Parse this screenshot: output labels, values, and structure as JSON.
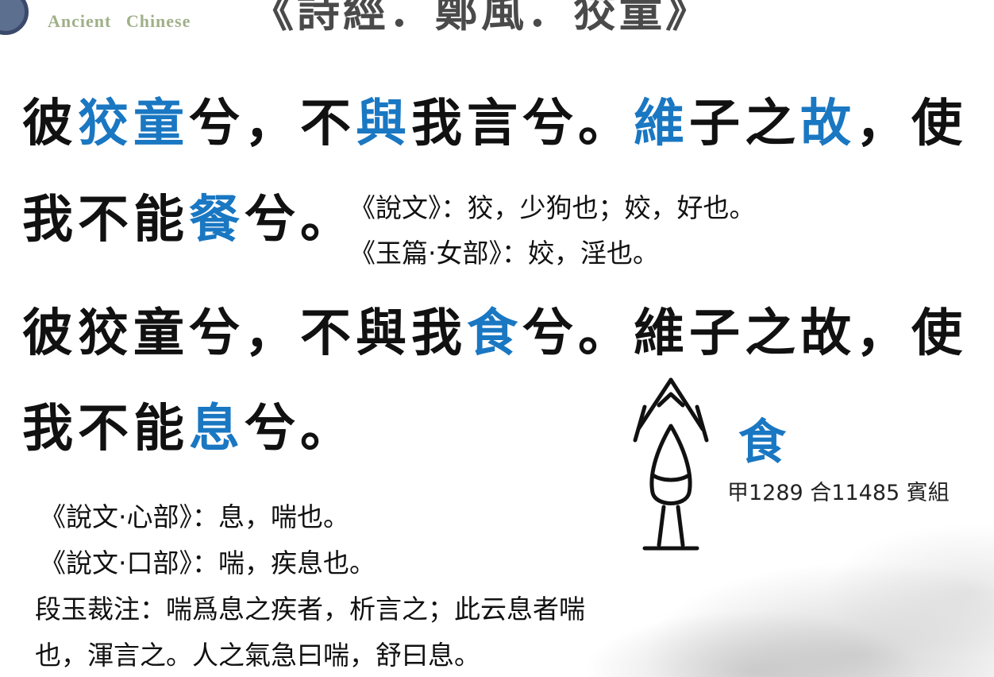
{
  "header": {
    "logo_text": "Ancient Chinese",
    "title": "《詩經．鄭風．狡童》"
  },
  "verses": [
    {
      "segments": [
        {
          "text": "彼",
          "hl": false
        },
        {
          "text": "狡童",
          "hl": true
        },
        {
          "text": "兮，不",
          "hl": false
        },
        {
          "text": "與",
          "hl": true
        },
        {
          "text": "我言兮。",
          "hl": false
        },
        {
          "text": "維",
          "hl": true
        },
        {
          "text": "子之",
          "hl": false
        },
        {
          "text": "故",
          "hl": true
        },
        {
          "text": "，使",
          "hl": false
        }
      ]
    },
    {
      "segments": [
        {
          "text": "我不能",
          "hl": false
        },
        {
          "text": "餐",
          "hl": true
        },
        {
          "text": "兮。",
          "hl": false
        }
      ]
    },
    {
      "segments": [
        {
          "text": "彼狡童兮，不與我",
          "hl": false
        },
        {
          "text": "食",
          "hl": true
        },
        {
          "text": "兮。維子之故，使",
          "hl": false
        }
      ]
    },
    {
      "segments": [
        {
          "text": "我不能",
          "hl": false
        },
        {
          "text": "息",
          "hl": true
        },
        {
          "text": "兮。",
          "hl": false
        }
      ]
    }
  ],
  "notes_top": [
    "《說文》：狡，少狗也；姣，好也。",
    "《玉篇·女部》：姣，淫也。"
  ],
  "notes_bottom": [
    "《說文·心部》：息，喘也。",
    "《說文·口部》：喘，疾息也。",
    "段玉裁注：喘爲息之疾者，析言之；此云息者喘",
    "也，渾言之。人之氣急曰喘，舒曰息。"
  ],
  "glyph": {
    "character": "食",
    "source": "甲1289 合11485 賓組"
  },
  "colors": {
    "highlight": "#1a77c2",
    "text": "#111111",
    "logo": "#9fb089"
  }
}
